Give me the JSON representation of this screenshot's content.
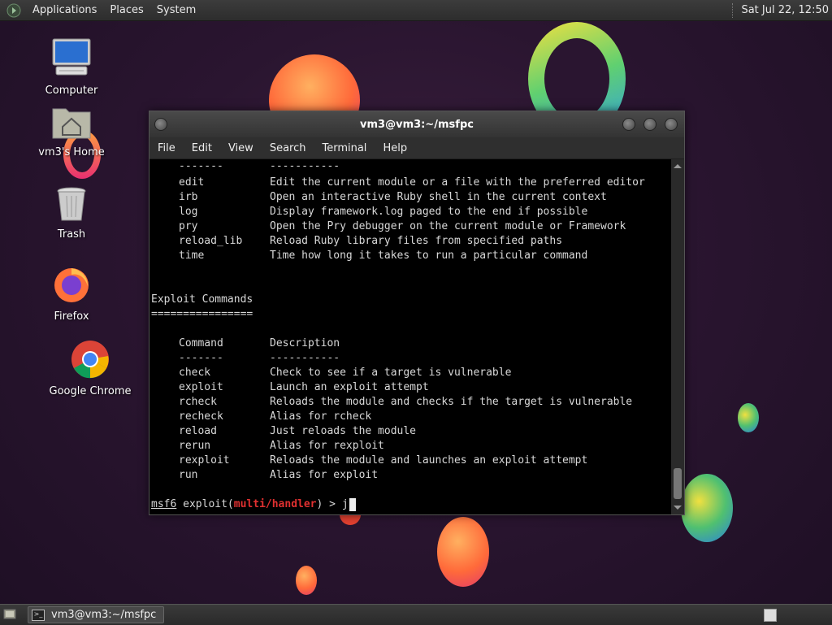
{
  "top_panel": {
    "menus": [
      "Applications",
      "Places",
      "System"
    ],
    "clock": "Sat Jul 22, 12:50"
  },
  "desktop_icons": [
    {
      "label": "Computer",
      "icon": "computer-icon"
    },
    {
      "label": "vm3's Home",
      "icon": "home-folder-icon"
    },
    {
      "label": "Trash",
      "icon": "trash-icon"
    },
    {
      "label": "Firefox",
      "icon": "firefox-icon"
    },
    {
      "label": "Google Chrome",
      "icon": "chrome-icon"
    }
  ],
  "terminal": {
    "title": "vm3@vm3:~/msfpc",
    "menu": [
      "File",
      "Edit",
      "View",
      "Search",
      "Terminal",
      "Help"
    ],
    "dev_commands": [
      {
        "cmd": "-------",
        "desc": "-----------"
      },
      {
        "cmd": "edit",
        "desc": "Edit the current module or a file with the preferred editor"
      },
      {
        "cmd": "irb",
        "desc": "Open an interactive Ruby shell in the current context"
      },
      {
        "cmd": "log",
        "desc": "Display framework.log paged to the end if possible"
      },
      {
        "cmd": "pry",
        "desc": "Open the Pry debugger on the current module or Framework"
      },
      {
        "cmd": "reload_lib",
        "desc": "Reload Ruby library files from specified paths"
      },
      {
        "cmd": "time",
        "desc": "Time how long it takes to run a particular command"
      }
    ],
    "section_title": "Exploit Commands",
    "section_rule": "================",
    "header": {
      "cmd": "Command",
      "desc": "Description"
    },
    "header_rule": {
      "cmd": "-------",
      "desc": "-----------"
    },
    "exploit_commands": [
      {
        "cmd": "check",
        "desc": "Check to see if a target is vulnerable"
      },
      {
        "cmd": "exploit",
        "desc": "Launch an exploit attempt"
      },
      {
        "cmd": "rcheck",
        "desc": "Reloads the module and checks if the target is vulnerable"
      },
      {
        "cmd": "recheck",
        "desc": "Alias for rcheck"
      },
      {
        "cmd": "reload",
        "desc": "Just reloads the module"
      },
      {
        "cmd": "rerun",
        "desc": "Alias for rexploit"
      },
      {
        "cmd": "rexploit",
        "desc": "Reloads the module and launches an exploit attempt"
      },
      {
        "cmd": "run",
        "desc": "Alias for exploit"
      }
    ],
    "prompt": {
      "user": "msf6",
      "mid": " exploit(",
      "module": "multi/handler",
      "tail": ") > ",
      "input": "j"
    }
  },
  "taskbar": {
    "task_label": "vm3@vm3:~/msfpc"
  }
}
